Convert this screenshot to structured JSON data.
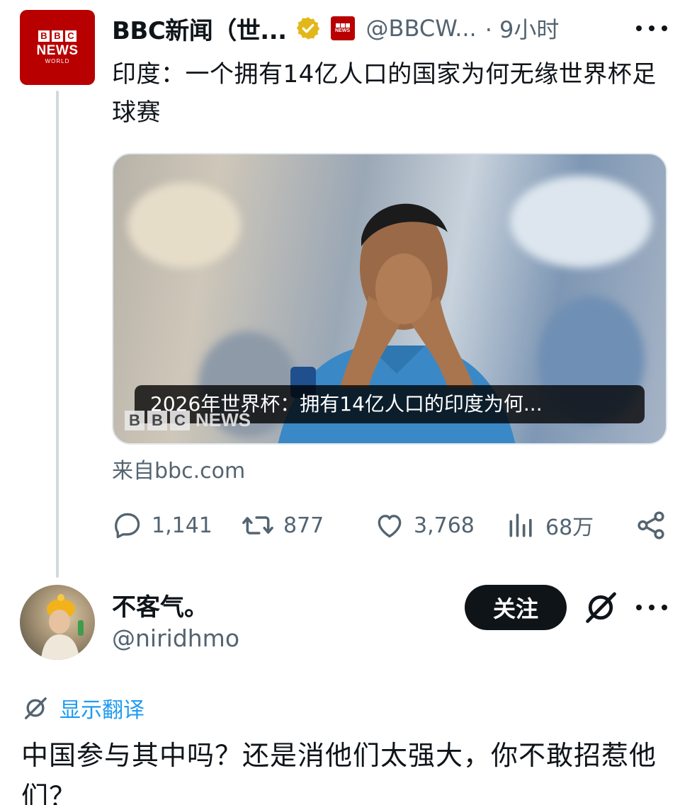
{
  "post": {
    "avatar_icon": "bbc-news-world-logo",
    "avatar_letters": [
      "B",
      "B",
      "C"
    ],
    "avatar_news": "NEWS",
    "avatar_world": "WORLD",
    "display_name": "BBC新闻（世...",
    "verified_icon": "gold-verified-badge",
    "affiliate_icon": "bbc-news-mini-logo",
    "handle": "@BBCW...",
    "time": "· 9小时",
    "more_icon": "more-dots-icon",
    "text": "印度：一个拥有14亿人口的国家为何无缘世界杯足球赛",
    "media": {
      "image": "footballer-in-blue-jersey-hands-over-face",
      "caption": "2026年世界杯：拥有14亿人口的印度为何...",
      "watermark_letters": [
        "B",
        "B",
        "C"
      ],
      "watermark_news": "NEWS"
    },
    "source": "来自bbc.com",
    "actions": {
      "replies": "1,141",
      "reposts": "877",
      "likes": "3,768",
      "views": "68万"
    }
  },
  "reply": {
    "avatar_icon": "child-with-yellow-hat-avatar",
    "name": "不客气。",
    "handle": "@niridhmo",
    "follow_label": "关注",
    "grok_icon": "grok-icon",
    "more_icon": "more-dots-icon",
    "translate_label": "显示翻译",
    "text": "中国参与其中吗？还是消他们太强大，你不敢招惹他们？"
  },
  "colors": {
    "brand_red": "#b80000",
    "link_blue": "#1d9bf0",
    "muted": "#536471",
    "text": "#0f1419"
  }
}
